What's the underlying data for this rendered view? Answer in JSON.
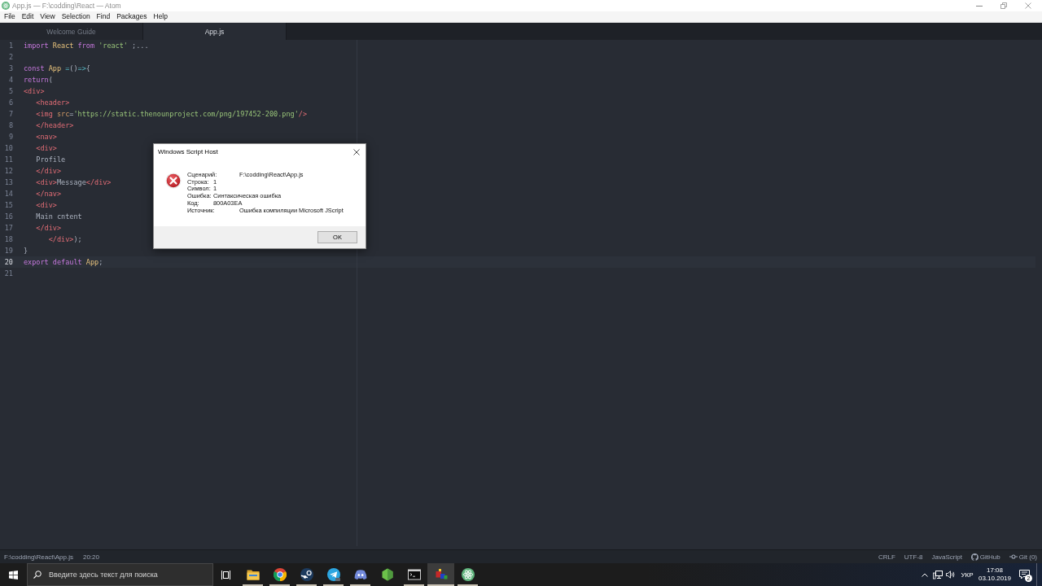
{
  "window": {
    "title": "App.js — F:\\codding\\React — Atom"
  },
  "menu": [
    "File",
    "Edit",
    "View",
    "Selection",
    "Find",
    "Packages",
    "Help"
  ],
  "tabs": [
    {
      "label": "Welcome Guide",
      "selected": false
    },
    {
      "label": "App.js",
      "selected": true
    }
  ],
  "editor": {
    "lines": [
      {
        "number": "1",
        "current": false,
        "tokens": [
          {
            "kind": "keyword",
            "text": "import "
          },
          {
            "kind": "name",
            "text": "React "
          },
          {
            "kind": "keyword",
            "text": "from "
          },
          {
            "kind": "string",
            "text": "'react'"
          },
          {
            "kind": "punct",
            "text": " ;..."
          }
        ]
      },
      {
        "number": "2",
        "current": false
      },
      {
        "number": "3",
        "current": false,
        "tokens": [
          {
            "kind": "keyword",
            "text": "const "
          },
          {
            "kind": "name",
            "text": "App "
          },
          {
            "kind": "operator",
            "text": "="
          },
          {
            "kind": "punct",
            "text": "()"
          },
          {
            "kind": "operator",
            "text": "=>"
          },
          {
            "kind": "punct",
            "text": "{"
          }
        ]
      },
      {
        "number": "4",
        "current": false,
        "tokens": [
          {
            "kind": "keyword",
            "text": "return"
          },
          {
            "kind": "punct",
            "text": "("
          }
        ]
      },
      {
        "number": "5",
        "current": false,
        "tokens": [
          {
            "kind": "tag",
            "text": "<div>"
          }
        ]
      },
      {
        "number": "6",
        "current": false,
        "tokens": [
          {
            "kind": "tag",
            "text": "   <header>"
          }
        ]
      },
      {
        "number": "7",
        "current": false,
        "tokens": [
          {
            "kind": "tag",
            "text": "   <img "
          },
          {
            "kind": "attribute",
            "text": "src"
          },
          {
            "kind": "punct",
            "text": "="
          },
          {
            "kind": "string",
            "text": "'https://static.thenounproject.com/png/197452-200.png'"
          },
          {
            "kind": "tag",
            "text": "/>"
          }
        ]
      },
      {
        "number": "8",
        "current": false,
        "tokens": [
          {
            "kind": "tag",
            "text": "   </header>"
          }
        ]
      },
      {
        "number": "9",
        "current": false,
        "tokens": [
          {
            "kind": "tag",
            "text": "   <nav>"
          }
        ]
      },
      {
        "number": "10",
        "current": false,
        "tokens": [
          {
            "kind": "tag",
            "text": "   <div>"
          }
        ]
      },
      {
        "number": "11",
        "current": false,
        "tokens": [
          {
            "kind": "text",
            "text": "   Profile"
          }
        ]
      },
      {
        "number": "12",
        "current": false,
        "tokens": [
          {
            "kind": "tag",
            "text": "   </div>"
          }
        ]
      },
      {
        "number": "13",
        "current": false,
        "tokens": [
          {
            "kind": "tag",
            "text": "   <div>"
          },
          {
            "kind": "text",
            "text": "Message"
          },
          {
            "kind": "tag",
            "text": "</div>"
          }
        ]
      },
      {
        "number": "14",
        "current": false,
        "tokens": [
          {
            "kind": "tag",
            "text": "   </nav>"
          }
        ]
      },
      {
        "number": "15",
        "current": false,
        "tokens": [
          {
            "kind": "tag",
            "text": "   <div>"
          }
        ]
      },
      {
        "number": "16",
        "current": false,
        "tokens": [
          {
            "kind": "text",
            "text": "   Main cntent"
          }
        ]
      },
      {
        "number": "17",
        "current": false,
        "tokens": [
          {
            "kind": "tag",
            "text": "   </div>"
          }
        ]
      },
      {
        "number": "18",
        "current": false,
        "tokens": [
          {
            "kind": "tag",
            "text": "      </div>"
          },
          {
            "kind": "punct",
            "text": ");"
          }
        ]
      },
      {
        "number": "19",
        "current": false,
        "tokens": [
          {
            "kind": "punct",
            "text": "}"
          }
        ]
      },
      {
        "number": "20",
        "current": true,
        "tokens": [
          {
            "kind": "keyword",
            "text": "export default "
          },
          {
            "kind": "name",
            "text": "App"
          },
          {
            "kind": "punct",
            "text": ";"
          }
        ]
      },
      {
        "number": "21",
        "current": false
      }
    ]
  },
  "dialog": {
    "title": "Windows Script Host",
    "rows": [
      {
        "label": "Сценарий:",
        "value": "F:\\codding\\React\\App.js"
      },
      {
        "label": "Строка:",
        "value": "1"
      },
      {
        "label": "Символ:",
        "value": "1"
      },
      {
        "label": "Ошибка:",
        "value": "Синтаксическая ошибка"
      },
      {
        "label": "Код:",
        "value": "800A03EA"
      },
      {
        "label": "Источник:",
        "value": "Ошибка компиляции Microsoft JScript"
      }
    ],
    "buttons": [
      "OK"
    ]
  },
  "status_bar": {
    "file_path": "F:\\codding\\React\\App.js",
    "cursor_position": "20:20",
    "line_ending": "CRLF",
    "encoding": "UTF-8",
    "grammar": "JavaScript",
    "github": "GitHub",
    "git": "Git (0)"
  },
  "taskbar": {
    "search": {
      "placeholder": "Введите здесь текст для поиска"
    },
    "apps": [
      {
        "kind": "folder",
        "selected": false,
        "running": true
      },
      {
        "kind": "browser",
        "selected": false,
        "running": true
      },
      {
        "kind": "steam",
        "selected": false,
        "running": true
      },
      {
        "kind": "plane",
        "selected": false,
        "running": true
      },
      {
        "kind": "controller",
        "selected": false,
        "running": true
      },
      {
        "kind": "hexagon",
        "selected": false,
        "running": false
      },
      {
        "kind": "terminal",
        "selected": false,
        "running": true
      },
      {
        "kind": "blocks",
        "selected": true,
        "running": true
      },
      {
        "kind": "atom",
        "selected": false,
        "running": true
      }
    ],
    "tray": {
      "language": "УКР",
      "time": "17:08",
      "date": "03.10.2019",
      "notification_count": "2"
    }
  }
}
